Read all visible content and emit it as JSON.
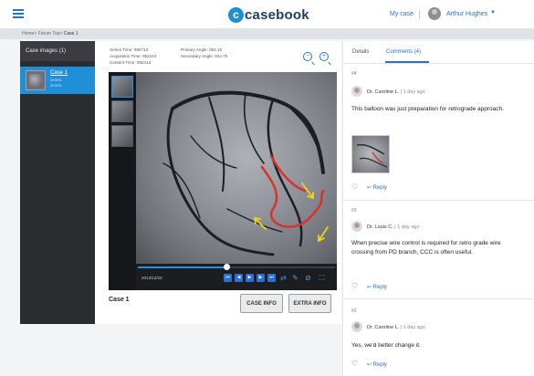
{
  "header": {
    "logo_letter": "c",
    "logo_text": "casebook",
    "my_case": "My case",
    "user_name": "Arthur Hughes",
    "caret": "▼"
  },
  "breadcrumb": {
    "items": [
      "Home",
      "Forum Top",
      "Case 1"
    ]
  },
  "sidebar": {
    "title": "Case images (1)",
    "case": {
      "link": "Case 1",
      "sub1": "2KSFA",
      "sub2": "2KSFA"
    }
  },
  "viewer": {
    "meta": {
      "series_time": "Series Time: 090713",
      "acquisition_time": "Acquisition Time: 092413",
      "content_time": "Content Time: 092413",
      "primary_angle": "Primary Angle: 002.10",
      "secondary_angle": "Secondary Angle: 024.75"
    },
    "zoom_out_icon": "zoom-out-icon",
    "zoom_in_icon": "zoom-in-icon",
    "timecode": "2013/12/20",
    "progress": 0.45,
    "controls": [
      "first-frame-icon",
      "previous-frame-icon",
      "play-icon",
      "next-frame-icon",
      "last-frame-icon",
      "loop-icon",
      "pen-icon",
      "link-icon",
      "fullscreen-icon"
    ]
  },
  "footer": {
    "case_title": "Case 1",
    "case_info": "CASE INFO",
    "extra_info": "EXTRA INFO"
  },
  "right_panel": {
    "tabs": [
      "Details",
      "Comments (4)"
    ],
    "comments": [
      {
        "num": "#4",
        "author": "Dr. Caroline L.",
        "time": "1 day ago",
        "text": "This balloon was just preparation for retrograde approach.",
        "has_image": true,
        "reply": "Reply"
      },
      {
        "num": "#3",
        "author": "Dr. Louis C.",
        "time": "1 day ago",
        "text": "When precise wire control is required for retro grade wire crossing from PD branch, CCC is often useful.",
        "has_image": false,
        "reply": "Reply"
      },
      {
        "num": "#2",
        "author": "Dr. Caroline L.",
        "time": "1 day ago",
        "text": "Yes, we'd better change it.",
        "has_image": false,
        "reply": "Reply"
      }
    ]
  },
  "colors": {
    "accent": "#2a6fd6",
    "sidebar_active": "#1f8fd8",
    "annotation_red": "#d9322b",
    "annotation_yellow": "#f0d21e"
  }
}
